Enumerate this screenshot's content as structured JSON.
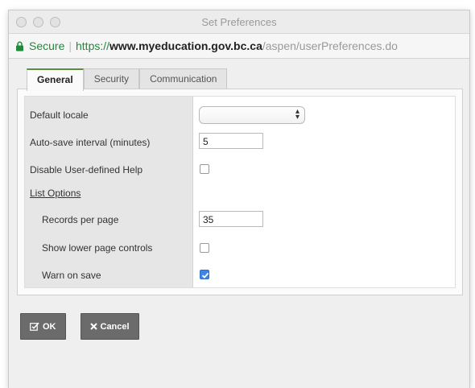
{
  "window": {
    "title": "Set Preferences"
  },
  "url": {
    "secure_label": "Secure",
    "protocol": "https://",
    "domain": "www.myeducation.gov.bc.ca",
    "path": "/aspen/userPreferences.do"
  },
  "tabs": [
    {
      "label": "General",
      "active": true
    },
    {
      "label": "Security",
      "active": false
    },
    {
      "label": "Communication",
      "active": false
    }
  ],
  "form": {
    "default_locale": {
      "label": "Default locale",
      "value": ""
    },
    "autosave": {
      "label": "Auto-save interval (minutes)",
      "value": "5"
    },
    "disable_help": {
      "label": "Disable User-defined Help",
      "checked": false
    },
    "list_options_heading": "List Options",
    "records_per_page": {
      "label": "Records per page",
      "value": "35"
    },
    "show_lower_controls": {
      "label": "Show lower page controls",
      "checked": false
    },
    "warn_on_save": {
      "label": "Warn on save",
      "checked": true
    }
  },
  "buttons": {
    "ok": "OK",
    "cancel": "Cancel"
  },
  "colors": {
    "accent_green": "#5a8f3e",
    "secure_green": "#1e8a3a",
    "checkbox_blue": "#3b86e8",
    "button_gray": "#6b6b6b"
  }
}
